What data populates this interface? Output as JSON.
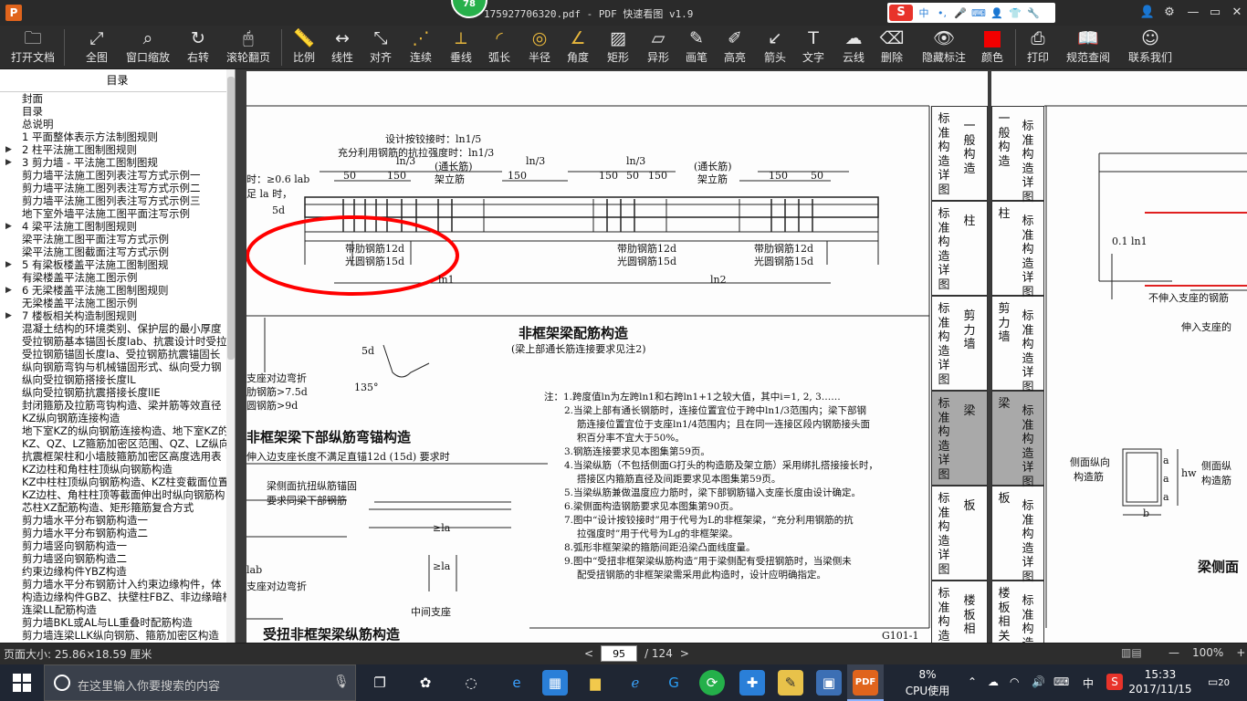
{
  "window": {
    "app_icon_letter": "P",
    "title": "175927706320.pdf - PDF 快速看图 v1.9",
    "badge_count": "78"
  },
  "ime": {
    "logo": "S",
    "lang": "中",
    "punct": "•,"
  },
  "toolbar": {
    "items": [
      {
        "label": "打开文档",
        "icon": "folder-icon"
      },
      {
        "label": "全图",
        "icon": "fit-icon"
      },
      {
        "label": "窗口缩放",
        "icon": "zoom-icon"
      },
      {
        "label": "右转",
        "icon": "rotate-icon"
      },
      {
        "label": "滚轮翻页",
        "icon": "mouse-icon"
      },
      {
        "label": "比例",
        "icon": "ruler-icon"
      },
      {
        "label": "线性",
        "icon": "linear-icon"
      },
      {
        "label": "对齐",
        "icon": "align-icon"
      },
      {
        "label": "连续",
        "icon": "continuous-icon"
      },
      {
        "label": "垂线",
        "icon": "perpendicular-icon"
      },
      {
        "label": "弧长",
        "icon": "arc-icon"
      },
      {
        "label": "半径",
        "icon": "radius-icon"
      },
      {
        "label": "角度",
        "icon": "angle-icon"
      },
      {
        "label": "矩形",
        "icon": "rect-icon"
      },
      {
        "label": "异形",
        "icon": "polygon-icon"
      },
      {
        "label": "画笔",
        "icon": "pen-icon"
      },
      {
        "label": "高亮",
        "icon": "highlight-icon"
      },
      {
        "label": "箭头",
        "icon": "arrow-icon"
      },
      {
        "label": "文字",
        "icon": "text-icon"
      },
      {
        "label": "云线",
        "icon": "cloud-icon"
      },
      {
        "label": "删除",
        "icon": "eraser-icon"
      },
      {
        "label": "隐藏标注",
        "icon": "eye-icon"
      },
      {
        "label": "颜色",
        "icon": "color-icon"
      },
      {
        "label": "打印",
        "icon": "print-icon"
      },
      {
        "label": "规范查阅",
        "icon": "book-icon"
      },
      {
        "label": "联系我们",
        "icon": "contact-icon"
      }
    ]
  },
  "sidebar": {
    "title": "目录",
    "items": [
      {
        "text": "封面",
        "arrow": ""
      },
      {
        "text": "目录",
        "arrow": ""
      },
      {
        "text": "总说明",
        "arrow": ""
      },
      {
        "text": "1 平面整体表示方法制图规则",
        "arrow": ""
      },
      {
        "text": "2 柱平法施工图制图规则",
        "arrow": "▶"
      },
      {
        "text": "3 剪力墙 - 平法施工图制图规",
        "arrow": "▶"
      },
      {
        "text": "剪力墙平法施工图列表注写方式示例一",
        "arrow": ""
      },
      {
        "text": "剪力墙平法施工图列表注写方式示例二",
        "arrow": ""
      },
      {
        "text": "剪力墙平法施工图列表注写方式示例三",
        "arrow": ""
      },
      {
        "text": "地下室外墙平法施工图平面注写示例",
        "arrow": ""
      },
      {
        "text": "4 梁平法施工图制图规则",
        "arrow": "▶"
      },
      {
        "text": "梁平法施工图平面注写方式示例",
        "arrow": ""
      },
      {
        "text": "梁平法施工图截面注写方式示例",
        "arrow": ""
      },
      {
        "text": "5 有梁板楼盖平法施工图制图规",
        "arrow": "▶"
      },
      {
        "text": "有梁楼盖平法施工图示例",
        "arrow": ""
      },
      {
        "text": "6 无梁楼盖平法施工图制图规则",
        "arrow": "▶"
      },
      {
        "text": "无梁楼盖平法施工图示例",
        "arrow": ""
      },
      {
        "text": "7 楼板相关构造制图规则",
        "arrow": "▶"
      },
      {
        "text": "混凝土结构的环境类别、保护层的最小厚度",
        "arrow": ""
      },
      {
        "text": "受拉钢筋基本锚固长度lab、抗震设计时受拉",
        "arrow": ""
      },
      {
        "text": "受拉钢筋锚固长度la、受拉钢筋抗震锚固长",
        "arrow": ""
      },
      {
        "text": "纵向钢筋弯钩与机械锚固形式、纵向受力钢",
        "arrow": ""
      },
      {
        "text": "纵向受拉钢筋搭接长度lL",
        "arrow": ""
      },
      {
        "text": "纵向受拉钢筋抗震搭接长度llE",
        "arrow": ""
      },
      {
        "text": "封闭箍筋及拉筋弯钩构造、梁并筋等效直径",
        "arrow": ""
      },
      {
        "text": "KZ纵向钢筋连接构造",
        "arrow": ""
      },
      {
        "text": "地下室KZ的纵向钢筋连接构造、地下室KZ的",
        "arrow": ""
      },
      {
        "text": "KZ、QZ、LZ箍筋加密区范围、QZ、LZ纵向钢",
        "arrow": ""
      },
      {
        "text": "抗震框架柱和小墙肢箍筋加密区高度选用表",
        "arrow": ""
      },
      {
        "text": "KZ边柱和角柱柱顶纵向钢筋构造",
        "arrow": ""
      },
      {
        "text": "KZ中柱柱顶纵向钢筋构造、KZ柱变截面位置",
        "arrow": ""
      },
      {
        "text": "KZ边柱、角柱柱顶等截面伸出时纵向钢筋构",
        "arrow": ""
      },
      {
        "text": "芯柱XZ配筋构造、矩形箍筋复合方式",
        "arrow": ""
      },
      {
        "text": "剪力墙水平分布钢筋构造一",
        "arrow": ""
      },
      {
        "text": "剪力墙水平分布钢筋构造二",
        "arrow": ""
      },
      {
        "text": "剪力墙竖向钢筋构造一",
        "arrow": ""
      },
      {
        "text": "剪力墙竖向钢筋构造二",
        "arrow": ""
      },
      {
        "text": "约束边缘构件YBZ构造",
        "arrow": ""
      },
      {
        "text": "剪力墙水平分布钢筋计入约束边缘构件，体",
        "arrow": ""
      },
      {
        "text": "构造边缘构件GBZ、扶壁柱FBZ、非边缘暗柱",
        "arrow": ""
      },
      {
        "text": "连梁LL配筋构造",
        "arrow": ""
      },
      {
        "text": "剪力墙BKL或AL与LL重叠时配筋构造",
        "arrow": ""
      },
      {
        "text": "剪力墙连梁LLK纵向钢筋、箍筋加密区构造",
        "arrow": ""
      }
    ]
  },
  "doc": {
    "page1": {
      "top_notes": [
        "设计按铰接时：ln1/5",
        "充分利用钢筋的抗拉强度时：ln1/3"
      ],
      "left_labels": [
        "时：≥0.6 lab",
        "足 la 时，"
      ],
      "dims": [
        "50",
        "150",
        "ln/3",
        "150",
        "ln/3",
        "150",
        "50",
        "150",
        "ln/3",
        "150",
        "50",
        "5d",
        "ln1",
        "ln2"
      ],
      "rebar_labels_1": [
        "(通长筋)",
        "架立筋"
      ],
      "rebar_labels_2": [
        "(通长筋)",
        "架立筋"
      ],
      "bar_type_a": [
        "带肋钢筋12d",
        "光圆钢筋15d"
      ],
      "bar_type_b": [
        "带肋钢筋12d",
        "光圆钢筋15d"
      ],
      "bar_type_c": [
        "带肋钢筋12d",
        "光圆钢筋15d"
      ],
      "main_title": "非框架梁配筋构造",
      "main_subtitle": "(梁上部通长筋连接要求见注2)",
      "hook_labels": [
        "5d",
        "135°"
      ],
      "left_side_notes": [
        "支座对边弯折",
        "肋钢筋>7.5d",
        "圆钢筋>9d"
      ],
      "section2_title": "非框架梁下部纵筋弯锚构造",
      "section2_sub": "伸入边支座长度不满足直锚12d (15d) 要求时",
      "torsion_notes": [
        "梁侧面抗扭纵筋锚固",
        "要求同梁下部钢筋"
      ],
      "bottom_labels": [
        "lab",
        "支座对边弯折",
        "中间支座",
        "≥la",
        "≥la"
      ],
      "section3_title": "受扭非框架梁纵筋构造",
      "notes": [
        "注：1.跨度值ln为左跨ln1和右跨ln1+1之较大值，其中i=1, 2, 3……",
        "2.当梁上部有通长钢筋时，连接位置宜位于跨中ln1/3范围内；梁下部钢",
        "筋连接位置宜位于支座ln1/4范围内；且在同一连接区段内钢筋接头面",
        "积百分率不宜大于50%。",
        "3.钢筋连接要求见本图集第59页。",
        "4.当梁纵筋（不包括侧面G打头的构造筋及架立筋）采用绑扎搭接接长时，",
        "搭接区内箍筋直径及间距要求见本图集第59页。",
        "5.当梁纵筋兼做温度应力筋时，梁下部钢筋锚入支座长度由设计确定。",
        "6.梁侧面构造钢筋要求见本图集第90页。",
        "7.图中“设计按铰接时”用于代号为L的非框架梁，“充分利用钢筋的抗",
        "拉强度时”用于代号为Lg的非框架梁。",
        "8.弧形非框架梁的箍筋间距沿梁凸面线度量。",
        "9.图中“受扭非框架梁纵筋构造”用于梁侧配有受扭钢筋时，当梁侧未",
        "配受扭钢筋的非框架梁需采用此构造时，设计应明确指定。"
      ],
      "tabs": [
        {
          "left": "标准构造详图",
          "right": "一般构造"
        },
        {
          "left": "标准构造详图",
          "right": "柱"
        },
        {
          "left": "标准构造详图",
          "right": "剪力墙"
        },
        {
          "left": "标准构造详图",
          "right": "梁"
        },
        {
          "left": "标准构造详图",
          "right": "板"
        },
        {
          "left": "标准构造",
          "right": "楼板相"
        }
      ],
      "footer_code": "G101-1"
    },
    "page2": {
      "tabs": [
        {
          "left": "一般构造",
          "right": "标准构造详图"
        },
        {
          "left": "柱",
          "right": "标准构造详图"
        },
        {
          "left": "剪力墙",
          "right": "标准构造详图"
        },
        {
          "left": "梁",
          "right": "标准构造详图"
        },
        {
          "left": "板",
          "right": "标准构造详图"
        },
        {
          "left": "楼板相关",
          "right": "标准构造"
        }
      ],
      "labels": [
        "0.1 ln1",
        "不伸入支座的钢筋",
        "伸入支座的",
        "侧面纵向",
        "构造筋",
        "侧面纵",
        "构造筋",
        "hw",
        "a",
        "a",
        "a",
        "b",
        "梁侧面"
      ]
    }
  },
  "status": {
    "page_size": "页面大小: 25.86×18.59 厘米",
    "current_page": "95",
    "total_pages": "/ 124",
    "zoom": "100%",
    "prev": "<",
    "next": ">",
    "zoom_out": "—",
    "zoom_in": "+"
  },
  "taskbar": {
    "search_placeholder": "在这里输入你要搜索的内容",
    "cpu_percent": "8%",
    "cpu_label": "CPU使用",
    "lang": "中",
    "time": "15:33",
    "date": "2017/11/15",
    "notifications": "20"
  }
}
